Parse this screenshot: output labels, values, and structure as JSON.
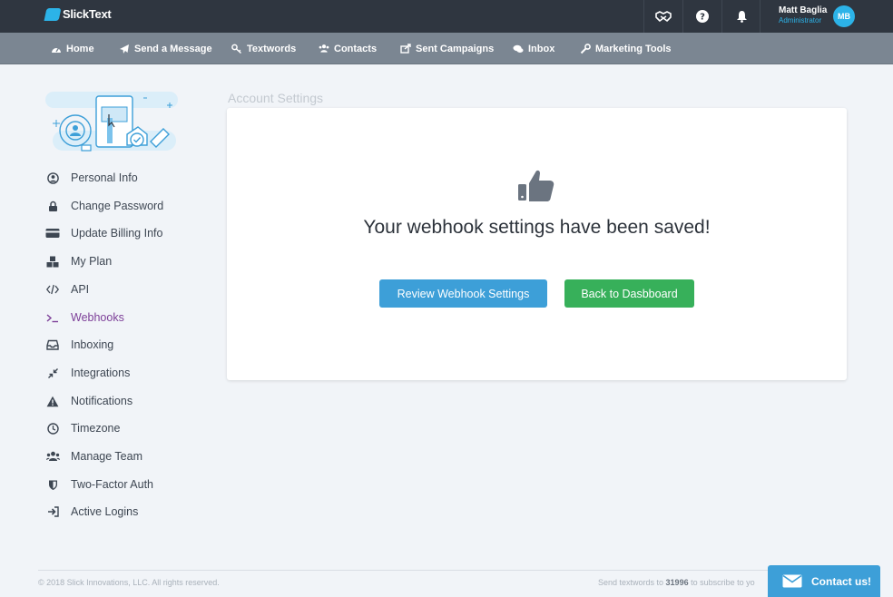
{
  "brand": {
    "name": "SlickText"
  },
  "user": {
    "name": "Matt Baglia",
    "role": "Administrator",
    "initials": "MB"
  },
  "top_icons": [
    "handshake-icon",
    "help-icon",
    "bell-icon"
  ],
  "nav": {
    "items": [
      {
        "label": "Home",
        "icon": "dashboard-icon"
      },
      {
        "label": "Send a Message",
        "icon": "paper-plane-icon"
      },
      {
        "label": "Textwords",
        "icon": "key-icon"
      },
      {
        "label": "Contacts",
        "icon": "users-icon"
      },
      {
        "label": "Sent Campaigns",
        "icon": "share-icon"
      },
      {
        "label": "Inbox",
        "icon": "chat-icon"
      },
      {
        "label": "Marketing Tools",
        "icon": "wrench-icon"
      }
    ]
  },
  "sidebar": {
    "items": [
      {
        "label": "Personal Info",
        "icon": "user-circle-icon"
      },
      {
        "label": "Change Password",
        "icon": "lock-icon"
      },
      {
        "label": "Update Billing Info",
        "icon": "credit-card-icon"
      },
      {
        "label": "My Plan",
        "icon": "cubes-icon"
      },
      {
        "label": "API",
        "icon": "code-icon"
      },
      {
        "label": "Webhooks",
        "icon": "terminal-icon",
        "active": true
      },
      {
        "label": "Inboxing",
        "icon": "inbox-icon"
      },
      {
        "label": "Integrations",
        "icon": "compress-icon"
      },
      {
        "label": "Notifications",
        "icon": "warning-icon"
      },
      {
        "label": "Timezone",
        "icon": "clock-icon"
      },
      {
        "label": "Manage Team",
        "icon": "team-icon"
      },
      {
        "label": "Two-Factor Auth",
        "icon": "shield-icon"
      },
      {
        "label": "Active Logins",
        "icon": "sign-in-icon"
      }
    ]
  },
  "main": {
    "heading": "Account Settings",
    "message": "Your webhook settings have been saved!",
    "review_button": "Review Webhook Settings",
    "back_button": "Back to Dasbboard"
  },
  "footer": {
    "copyright": "© 2018 Slick Innovations, LLC. All rights reserved.",
    "subscribe_prefix": "Send textwords to ",
    "subscribe_number": "31996",
    "subscribe_suffix": " to subscribe to yo",
    "contact_label": "Contact us!"
  },
  "colors": {
    "topbar": "#2f3640",
    "navbar": "#7b8692",
    "accent": "#2cb3e8",
    "active": "#7d3f98",
    "review_button": "#3d9fd8",
    "back_button": "#37b05a"
  }
}
